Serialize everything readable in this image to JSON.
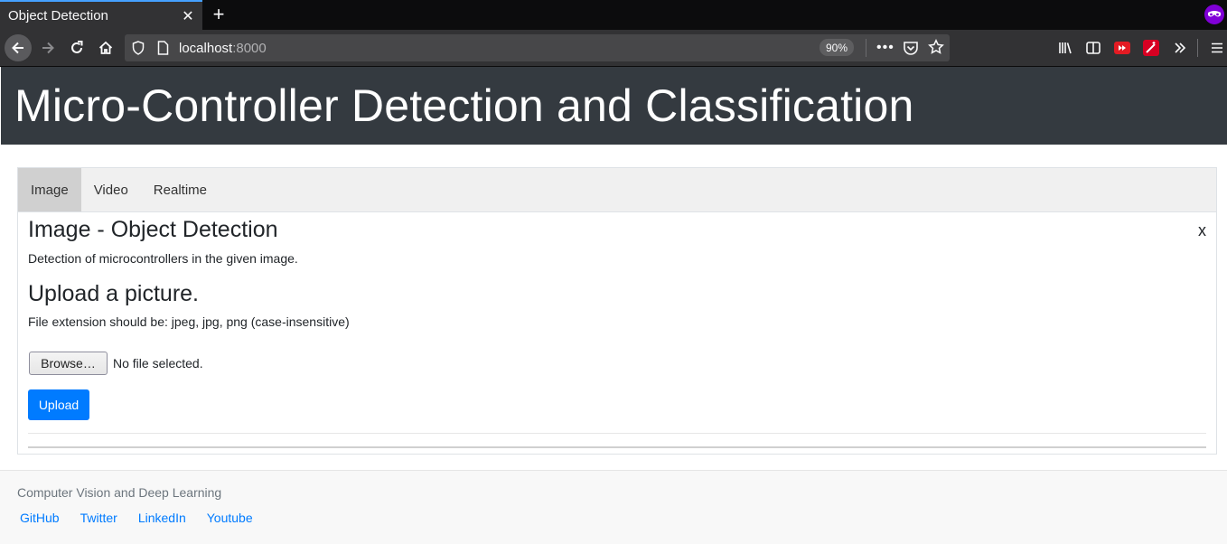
{
  "browser": {
    "tab_title": "Object Detection",
    "tab_close": "✕",
    "new_tab": "+",
    "url_host": "localhost",
    "url_port": ":8000",
    "zoom": "90%"
  },
  "header": {
    "title": "Micro-Controller Detection and Classification"
  },
  "tabs": [
    {
      "label": "Image"
    },
    {
      "label": "Video"
    },
    {
      "label": "Realtime"
    }
  ],
  "content": {
    "title": "Image - Object Detection",
    "close": "x",
    "description": "Detection of microcontrollers in the given image.",
    "upload_heading": "Upload a picture.",
    "extension_note": "File extension should be: jpeg, jpg, png (case-insensitive)",
    "browse_label": "Browse…",
    "file_status": "No file selected.",
    "upload_label": "Upload"
  },
  "footer": {
    "text": "Computer Vision and Deep Learning",
    "links": [
      {
        "label": "GitHub"
      },
      {
        "label": "Twitter"
      },
      {
        "label": "LinkedIn"
      },
      {
        "label": "Youtube"
      }
    ]
  },
  "colors": {
    "accent": "#007bff",
    "header_bg": "#343a40",
    "private_badge": "#8000d7"
  }
}
